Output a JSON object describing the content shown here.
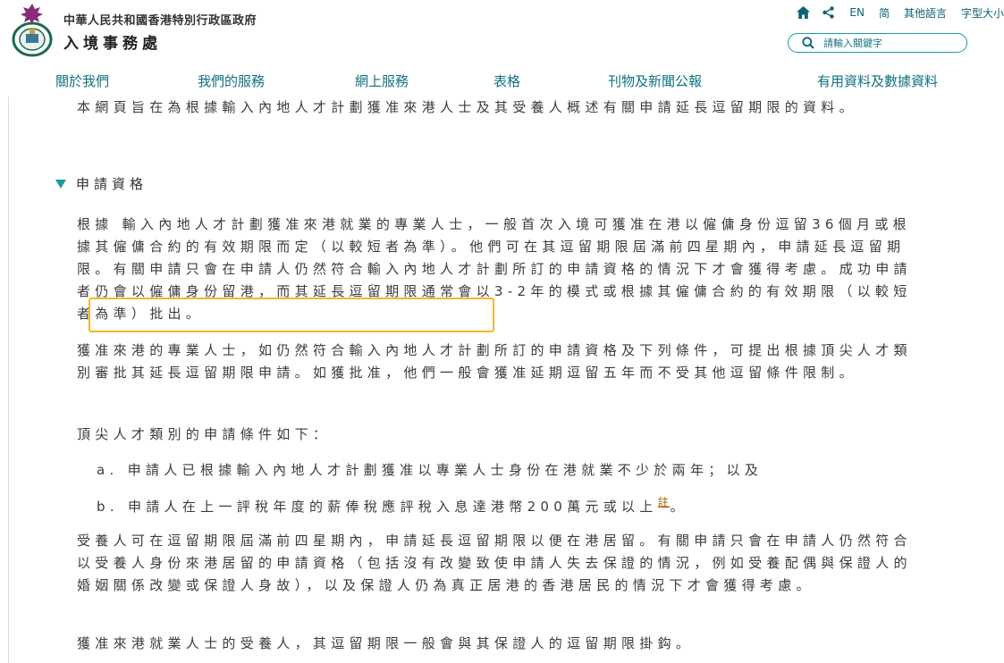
{
  "header": {
    "gov_name": "中華人民共和國香港特別行政區政府",
    "dept_name": "入境事務處",
    "utility": {
      "icons": [
        "home-icon",
        "share-icon"
      ],
      "lang_en": "EN",
      "lang_sc": "简",
      "other_lang": "其他語言",
      "font_size": "字型大小"
    },
    "search": {
      "placeholder": "請輸入關鍵字"
    }
  },
  "nav": {
    "items": [
      "關於我們",
      "我們的服務",
      "網上服務",
      "表格",
      "刊物及新聞公報",
      "有用資料及數據資料"
    ]
  },
  "content": {
    "intro": "本網頁旨在為根據輸入內地人才計劃獲准來港人士及其受養人概述有關申請延長逗留期限的資料。",
    "section_title": "申請資格",
    "p1": "根據 輸入內地人才計劃獲准來港就業的專業人士，一般首次入境可獲准在港以僱傭身份逗留36個月或根據其僱傭合約的有效期限而定（以較短者為準）。他們可在其逗留期限屆滿前四星期內，申請延長逗留期限。有關申請只會在申請人仍然符合輸入內地人才計劃所訂的申請資格的情況下才會獲得考慮。成功申請者仍會以僱傭身份留港，而其延長逗留期限通常會以3-2年的模式或根據其僱傭合約的有效期限（以較短者為準）批出。",
    "p2": "獲准來港的專業人士，如仍然符合輸入內地人才計劃所訂的申請資格及下列條件，可提出根據頂尖人才類別審批其延長逗留期限申請。如獲批准，他們一般會獲准延期逗留五年而不受其他逗留條件限制。",
    "p3": "頂尖人才類別的申請條件如下：",
    "item_a_marker": "a.",
    "item_a": "申請人已根據輸入內地人才計劃獲准以專業人士身份在港就業不少於兩年；以及",
    "item_b_marker": "b.",
    "item_b": "申請人在上一評稅年度的薪俸稅應評稅入息達港幣200萬元或以上",
    "item_b_note": "註",
    "item_b_end": "。",
    "p4": "受養人可在逗留期限屆滿前四星期內，申請延長逗留期限以便在港居留。有關申請只會在申請人仍然符合以受養人身份來港居留的申請資格（包括沒有改變致使申請人失去保證的情況，例如受養配偶與保證人的婚姻關係改變或保證人身故），以及保證人仍為真正居港的香港居民的情況下才會獲得考慮。",
    "p5": "獲准來港就業人士的受養人，其逗留期限一般會與其保證人的逗留期限掛鈎。"
  },
  "colors": {
    "accent": "#1a9aa9",
    "nav_text": "#10717f",
    "highlight": "#f2b72f",
    "note_link": "#b35a00"
  }
}
